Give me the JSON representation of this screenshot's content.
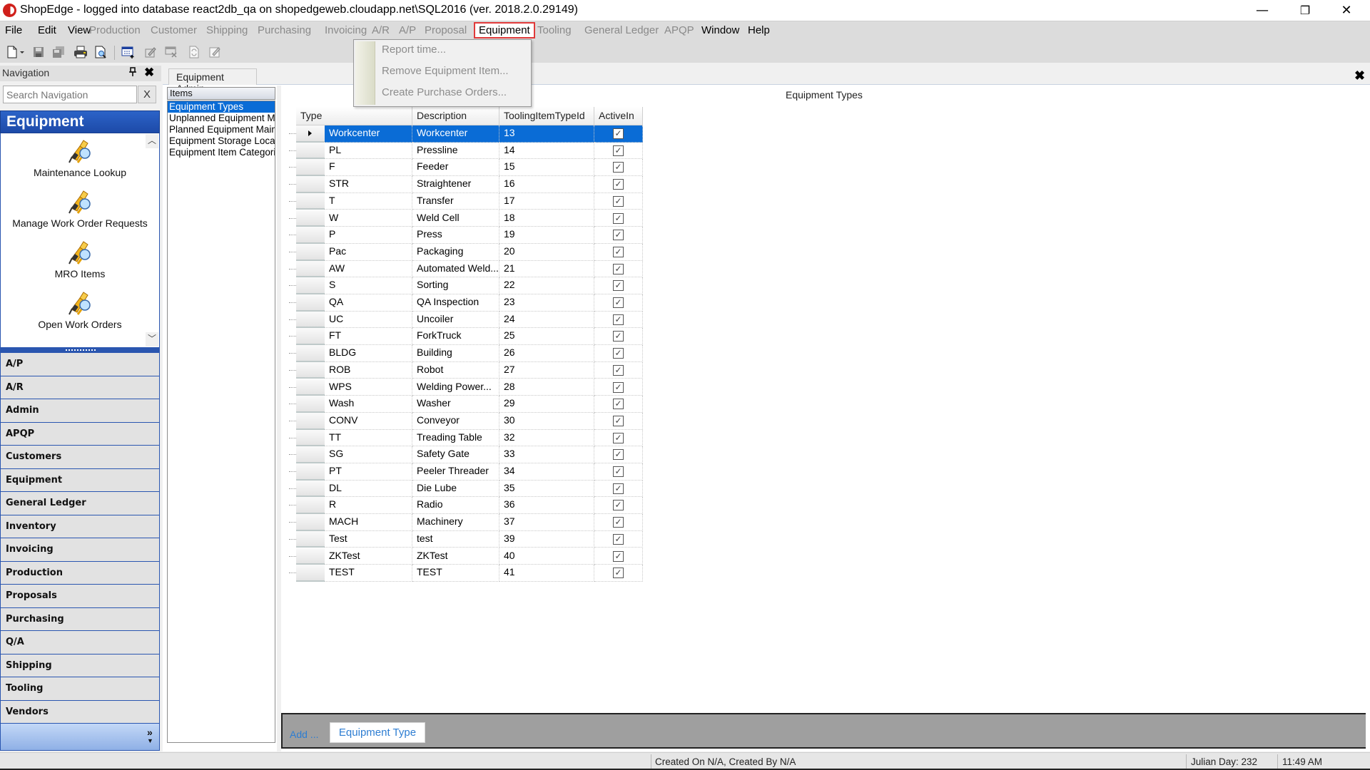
{
  "window": {
    "title": "ShopEdge -  logged into database react2db_qa on shopedgeweb.cloudapp.net\\SQL2016 (ver. 2018.2.0.29149)",
    "minimize": "—",
    "restore": "❐",
    "close": "✕"
  },
  "menubar": {
    "items": [
      {
        "label": "File",
        "enabled": true
      },
      {
        "label": "Edit",
        "enabled": true
      },
      {
        "label": "View",
        "enabled": true
      },
      {
        "label": "Production",
        "enabled": false
      },
      {
        "label": "Customer",
        "enabled": false
      },
      {
        "label": "Shipping",
        "enabled": false
      },
      {
        "label": "Purchasing",
        "enabled": false
      },
      {
        "label": "Invoicing",
        "enabled": false
      },
      {
        "label": "A/R",
        "enabled": false
      },
      {
        "label": "A/P",
        "enabled": false
      },
      {
        "label": "Proposal",
        "enabled": false
      },
      {
        "label": "Equipment",
        "enabled": true,
        "open": true
      },
      {
        "label": "Tooling",
        "enabled": false
      },
      {
        "label": "General Ledger",
        "enabled": false
      },
      {
        "label": "APQP",
        "enabled": false
      },
      {
        "label": "Window",
        "enabled": true
      },
      {
        "label": "Help",
        "enabled": true
      }
    ],
    "highlight_color": "#e03a3a"
  },
  "equipment_menu": {
    "items": [
      "Report time...",
      "Remove Equipment Item...",
      "Create Purchase Orders..."
    ]
  },
  "toolbar": {
    "icons": [
      "new-document-icon",
      "dropdown-arrow-icon",
      "save-icon",
      "save-all-icon",
      "print-icon",
      "print-preview-icon",
      "add-record-icon",
      "edit-record-icon",
      "delete-record-icon",
      "refresh-icon",
      "notes-icon"
    ]
  },
  "navigation": {
    "title": "Navigation",
    "pin": "🖈",
    "close": "✖",
    "search_placeholder": "Search Navigation",
    "search_clear": "X",
    "group_title": "Equipment",
    "tools": [
      {
        "label": "Maintenance Lookup"
      },
      {
        "label": "Manage Work Order Requests"
      },
      {
        "label": "MRO Items"
      },
      {
        "label": "Open Work Orders"
      }
    ],
    "sections": [
      "A/P",
      "A/R",
      "Admin",
      "APQP",
      "Customers",
      "Equipment",
      "General Ledger",
      "Inventory",
      "Invoicing",
      "Production",
      "Proposals",
      "Purchasing",
      "Q/A",
      "Shipping",
      "Tooling",
      "Vendors"
    ],
    "accent": "#2a56b0",
    "footer_chevron": "»"
  },
  "document": {
    "tab_label": "Equipment Admin",
    "close": "✖",
    "items_header": "Items",
    "items": [
      {
        "label": "Equipment Types",
        "selected": true
      },
      {
        "label": "Unplanned Equipment M",
        "selected": false
      },
      {
        "label": "Planned Equipment Main",
        "selected": false
      },
      {
        "label": "Equipment Storage Loca",
        "selected": false
      },
      {
        "label": "Equipment Item Categorie",
        "selected": false
      }
    ],
    "content_title": "Equipment Types"
  },
  "grid": {
    "columns": [
      "Type",
      "Description",
      "ToolingItemTypeId",
      "ActiveIn"
    ],
    "selection_color": "#0a6cd6",
    "rows": [
      {
        "type": "Workcenter",
        "description": "Workcenter",
        "id": "13",
        "active": true,
        "selected": true
      },
      {
        "type": "PL",
        "description": "Pressline",
        "id": "14",
        "active": true
      },
      {
        "type": "F",
        "description": "Feeder",
        "id": "15",
        "active": true
      },
      {
        "type": "STR",
        "description": "Straightener",
        "id": "16",
        "active": true
      },
      {
        "type": "T",
        "description": "Transfer",
        "id": "17",
        "active": true
      },
      {
        "type": "W",
        "description": "Weld Cell",
        "id": "18",
        "active": true
      },
      {
        "type": "P",
        "description": "Press",
        "id": "19",
        "active": true
      },
      {
        "type": "Pac",
        "description": "Packaging",
        "id": "20",
        "active": true
      },
      {
        "type": "AW",
        "description": "Automated  Weld...",
        "id": "21",
        "active": true
      },
      {
        "type": "S",
        "description": "Sorting",
        "id": "22",
        "active": true
      },
      {
        "type": "QA",
        "description": "QA Inspection",
        "id": "23",
        "active": true
      },
      {
        "type": "UC",
        "description": "Uncoiler",
        "id": "24",
        "active": true
      },
      {
        "type": "FT",
        "description": "ForkTruck",
        "id": "25",
        "active": true
      },
      {
        "type": "BLDG",
        "description": "Building",
        "id": "26",
        "active": true
      },
      {
        "type": "ROB",
        "description": "Robot",
        "id": "27",
        "active": true
      },
      {
        "type": "WPS",
        "description": "Welding  Power...",
        "id": "28",
        "active": true
      },
      {
        "type": "Wash",
        "description": "Washer",
        "id": "29",
        "active": true
      },
      {
        "type": "CONV",
        "description": "Conveyor",
        "id": "30",
        "active": true
      },
      {
        "type": "TT",
        "description": "Treading Table",
        "id": "32",
        "active": true
      },
      {
        "type": "SG",
        "description": "Safety Gate",
        "id": "33",
        "active": true
      },
      {
        "type": "PT",
        "description": "Peeler Threader",
        "id": "34",
        "active": true
      },
      {
        "type": "DL",
        "description": "Die Lube",
        "id": "35",
        "active": true
      },
      {
        "type": "R",
        "description": "Radio",
        "id": "36",
        "active": true
      },
      {
        "type": "MACH",
        "description": "Machinery",
        "id": "37",
        "active": true
      },
      {
        "type": "Test",
        "description": "test",
        "id": "39",
        "active": true
      },
      {
        "type": "ZKTest",
        "description": "ZKTest",
        "id": "40",
        "active": true
      },
      {
        "type": "TEST",
        "description": "TEST",
        "id": "41",
        "active": true
      }
    ]
  },
  "bottom_bar": {
    "add_label": "Add ...",
    "add_button": "Equipment Type",
    "link_color": "#2d7dd2"
  },
  "statusbar": {
    "created": "Created On N/A, Created By N/A",
    "julian_day": "Julian Day: 232",
    "time": "11:49 AM"
  }
}
